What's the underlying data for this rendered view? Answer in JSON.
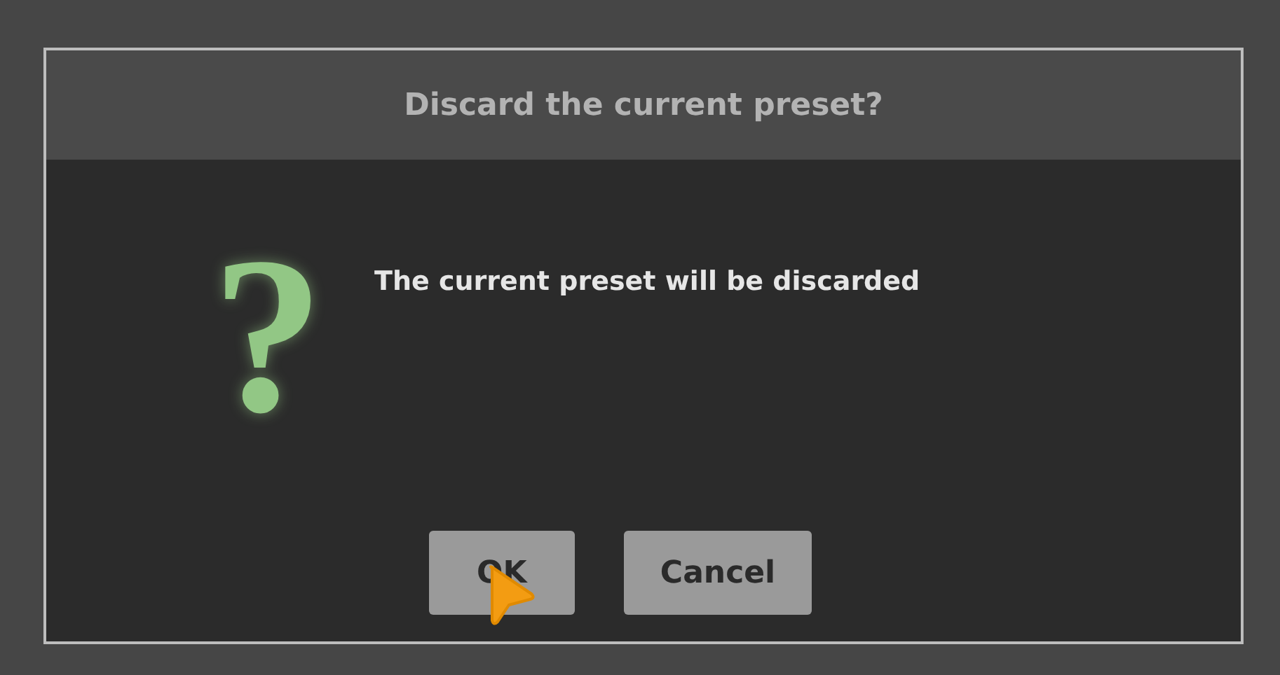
{
  "dialog": {
    "title": "Discard the current preset?",
    "icon": "?",
    "message": "The current preset will be discarded",
    "buttons": [
      {
        "label": "OK"
      },
      {
        "label": "Cancel"
      }
    ]
  }
}
